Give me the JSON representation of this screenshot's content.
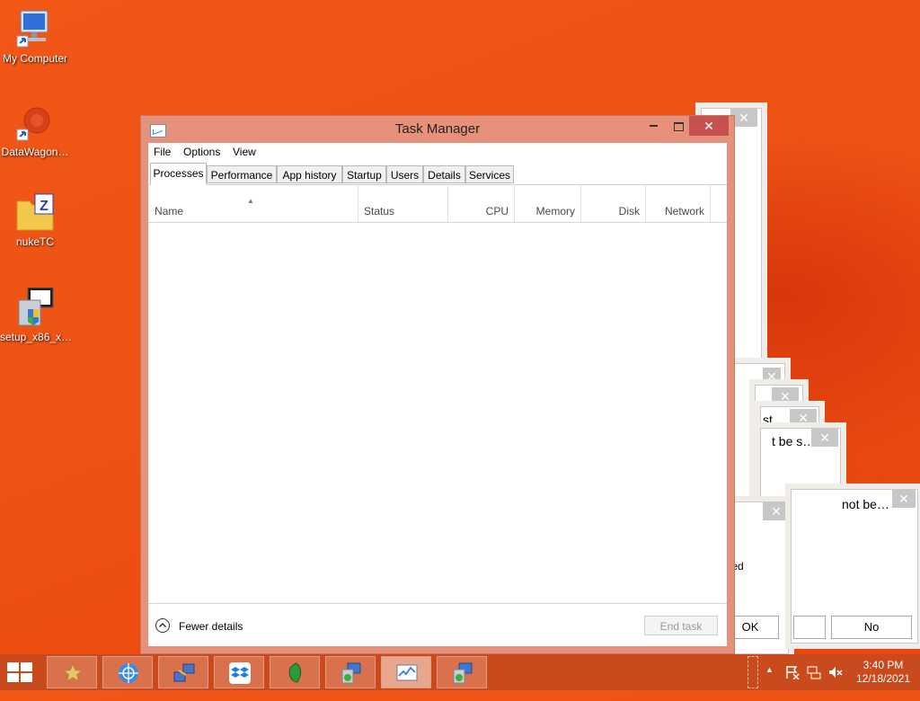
{
  "desktop": {
    "icons": [
      {
        "label": "My Computer",
        "icon": "computer-icon"
      },
      {
        "label": "DataWagon…",
        "icon": "datawagon-icon"
      },
      {
        "label": "nukeTC",
        "icon": "zip-folder-icon"
      },
      {
        "label": "setup_x86_x…",
        "icon": "installer-icon"
      }
    ]
  },
  "background_dialogs": {
    "texts": [
      "st…",
      "t be s…",
      "not be…",
      "lled"
    ],
    "buttons": [
      "OK",
      "No"
    ],
    "close_glyph": "✕"
  },
  "task_manager": {
    "title": "Task Manager",
    "close_glyph": "✕",
    "menu": [
      "File",
      "Options",
      "View"
    ],
    "tabs": [
      "Processes",
      "Performance",
      "App history",
      "Startup",
      "Users",
      "Details",
      "Services"
    ],
    "active_tab": "Processes",
    "columns": [
      "Name",
      "Status",
      "CPU",
      "Memory",
      "Disk",
      "Network"
    ],
    "sort_arrow": "▲",
    "footer": {
      "fewer_details_label": "Fewer details",
      "end_task_label": "End task"
    }
  },
  "taskbar": {
    "pinned": [
      {
        "name": "favorites-icon",
        "active": false
      },
      {
        "name": "network-globe-icon",
        "active": false
      },
      {
        "name": "remote-desktop-icon",
        "active": false
      },
      {
        "name": "dropbox-icon",
        "active": false
      },
      {
        "name": "green-gem-icon",
        "active": false
      },
      {
        "name": "setup-computer-icon",
        "active": false
      },
      {
        "name": "task-manager-icon",
        "active": true
      },
      {
        "name": "setup-computer-icon-2",
        "active": false
      }
    ],
    "tray_icons": [
      "show-hidden-icons-icon",
      "action-center-flag-icon",
      "network-icon",
      "volume-muted-icon"
    ],
    "show_hidden_glyph": "▲",
    "time": "3:40 PM",
    "date": "12/18/2021"
  },
  "colors": {
    "desktop_bg": "#ee5214",
    "taskbar_bg": "#c94a1d",
    "window_frame": "#e7917a",
    "close_button": "#c75050"
  }
}
